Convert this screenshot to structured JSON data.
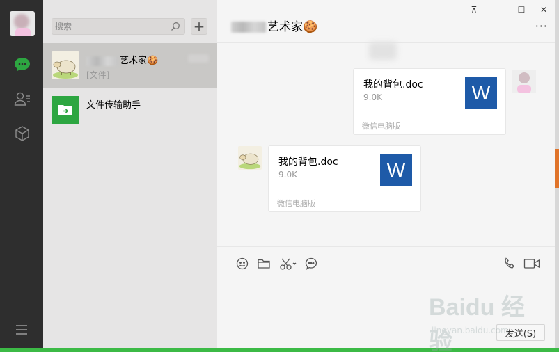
{
  "search": {
    "placeholder": "搜索"
  },
  "add_label": "+",
  "conversations": [
    {
      "name_suffix": "艺术家🍪",
      "preview": "[文件]"
    },
    {
      "name": "文件传输助手"
    }
  ],
  "chat": {
    "title_suffix": "艺术家🍪",
    "window_buttons": [
      "⊼",
      "—",
      "☐",
      "✕"
    ],
    "more": "···",
    "messages": [
      {
        "file_name": "我的背包.doc",
        "file_size": "9.0K",
        "source": "微信电脑版",
        "icon_letter": "W"
      },
      {
        "file_name": "我的背包.doc",
        "file_size": "9.0K",
        "source": "微信电脑版",
        "icon_letter": "W"
      }
    ],
    "send_label": "发送(S)"
  },
  "icons": [
    "chat-icon",
    "contacts-icon",
    "box-icon",
    "menu-icon",
    "search-icon",
    "emoji-icon",
    "folder-icon",
    "scissors-icon",
    "bubble-icon",
    "phone-icon",
    "video-icon"
  ],
  "watermark": {
    "title": "Baidu 经验",
    "sub": "jingyan.baidu.com"
  },
  "colors": {
    "rail": "#2e2e2e",
    "list": "#e6e5e5",
    "active": "#c9c8c6",
    "accent": "#2da641",
    "word": "#1e5aa8"
  }
}
